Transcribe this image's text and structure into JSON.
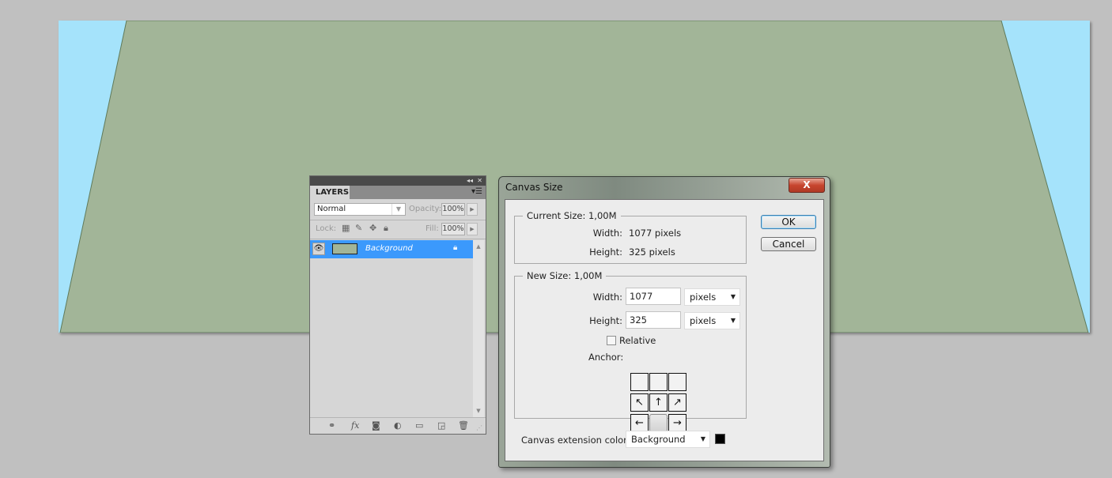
{
  "canvas": {
    "background_color": "#a5e3fb",
    "shape_color": "#a2b598",
    "shape_edge_color": "#5f7a5a"
  },
  "layers_panel": {
    "tab_label": "LAYERS",
    "collapse_icon": "double-chevron-left-icon",
    "close_icon": "close-icon",
    "menu_icon": "panel-menu-icon",
    "blend_mode": "Normal",
    "opacity_label": "Opacity:",
    "opacity_value": "100%",
    "lock_label": "Lock:",
    "fill_label": "Fill:",
    "fill_value": "100%",
    "layers": [
      {
        "name": "Background",
        "visible": true,
        "locked": true,
        "selected": true,
        "thumbnail_color": "#a2b598"
      }
    ],
    "bottom_icons": [
      "link-layers-icon",
      "fx-icon",
      "layer-mask-icon",
      "adjustment-layer-icon",
      "new-group-icon",
      "new-layer-icon",
      "trash-icon"
    ],
    "fx_label": "fx"
  },
  "dialog": {
    "title": "Canvas Size",
    "close_label": "X",
    "current_size": {
      "label": "Current Size: 1,00M",
      "width_label": "Width:",
      "width_value": "1077 pixels",
      "height_label": "Height:",
      "height_value": "325 pixels"
    },
    "new_size": {
      "label": "New Size: 1,00M",
      "width_label": "Width:",
      "width_value": "1077",
      "width_unit": "pixels",
      "height_label": "Height:",
      "height_value": "325",
      "height_unit": "pixels",
      "relative_label": "Relative",
      "relative_checked": false,
      "anchor_label": "Anchor:",
      "anchor_selected": "bottom-center",
      "anchor_arrows": [
        "",
        "",
        "",
        "↖",
        "↑",
        "↗",
        "←",
        "",
        "→"
      ]
    },
    "extension_color_label": "Canvas extension color:",
    "extension_color_value": "Background",
    "extension_swatch_color": "#000000",
    "ok_label": "OK",
    "cancel_label": "Cancel"
  }
}
